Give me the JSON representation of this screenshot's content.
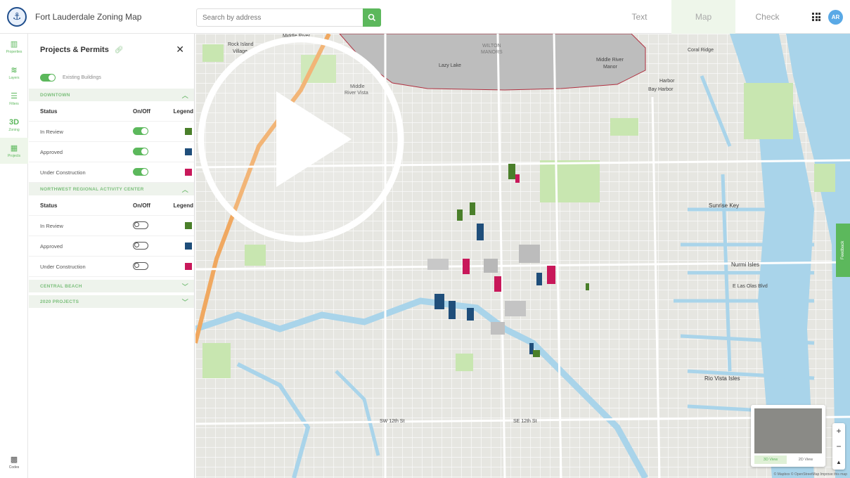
{
  "app": {
    "title": "Fort Lauderdale Zoning Map",
    "logo_icon": "city-logo-icon"
  },
  "search": {
    "placeholder": "Search by address",
    "icon": "search-icon"
  },
  "nav_tabs": [
    {
      "label": "Text",
      "active": false
    },
    {
      "label": "Map",
      "active": true
    },
    {
      "label": "Check",
      "active": false
    }
  ],
  "user": {
    "initials": "AR"
  },
  "rail": {
    "items": [
      {
        "label": "Properties",
        "icon": "building-icon",
        "active": false
      },
      {
        "label": "Layers",
        "icon": "layers-icon",
        "active": false
      },
      {
        "label": "Filters",
        "icon": "filter-icon",
        "active": false
      },
      {
        "label": "Zoning",
        "icon": "3d-icon",
        "glyph": "3D",
        "active": false
      },
      {
        "label": "Projects",
        "icon": "projects-icon",
        "active": true
      }
    ],
    "bottom": {
      "label": "Codes",
      "icon": "codes-icon"
    }
  },
  "panel": {
    "title": "Projects & Permits",
    "existing_buildings_label": "Existing Buildings",
    "existing_buildings_on": true,
    "columns": {
      "status": "Status",
      "onoff": "On/Off",
      "legend": "Legend"
    },
    "sections": [
      {
        "title": "DOWNTOWN",
        "expanded": true,
        "rows": [
          {
            "status": "In Review",
            "on": true,
            "color": "#4a7f2a"
          },
          {
            "status": "Approved",
            "on": true,
            "color": "#1f4e7a"
          },
          {
            "status": "Under Construction",
            "on": true,
            "color": "#c8185a"
          }
        ]
      },
      {
        "title": "NORTHWEST REGIONAL ACTIVITY CENTER",
        "expanded": true,
        "rows": [
          {
            "status": "In Review",
            "on": false,
            "color": "#4a7f2a"
          },
          {
            "status": "Approved",
            "on": false,
            "color": "#1f4e7a"
          },
          {
            "status": "Under Construction",
            "on": false,
            "color": "#c8185a"
          }
        ]
      },
      {
        "title": "CENTRAL BEACH",
        "expanded": false
      },
      {
        "title": "2020 PROJECTS",
        "expanded": false
      }
    ]
  },
  "map": {
    "labels": {
      "middle_river": "Middle River",
      "rock_island": "Rock Island",
      "village": "Village",
      "wilton": "WILTON",
      "manors": "MANORS",
      "lazy_lake": "Lazy Lake",
      "middle_river_vista1": "Middle",
      "middle_river_vista2": "River Vista",
      "middle_river_manor1": "Middle River",
      "middle_river_manor2": "Manor",
      "coral_ridge": "Coral Ridge",
      "harbor": "Harbor",
      "bayharbor": "Bay Harbor",
      "sunrise_key": "Sunrise Key",
      "nurmi_isles": "Nurmi Isles",
      "las_olas": "E Las Olas Blvd",
      "rio_vista": "Rio Vista Isles",
      "sw_12th": "SW 12th St",
      "se_12th": "SE 12th St"
    },
    "feedback_label": "Feedback",
    "minimap": {
      "satellite_label": "3D View",
      "map_label": "2D View"
    },
    "zoom": {
      "in": "+",
      "out": "−",
      "compass": "▲"
    },
    "attribution": "© Mapbox © OpenStreetMap  Improve this map"
  },
  "colors": {
    "accent": "#5cb85c",
    "in_review": "#4a7f2a",
    "approved": "#1f4e7a",
    "under_construction": "#c8185a",
    "water": "#a9d4ea",
    "park": "#c8e6b0"
  }
}
